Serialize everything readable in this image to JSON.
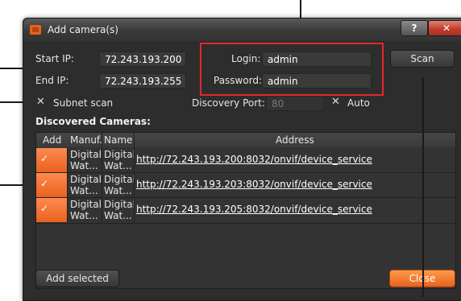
{
  "dialog": {
    "title": "Add camera(s)",
    "help_label": "?",
    "close_label": "✕"
  },
  "form": {
    "start_ip_label": "Start IP:",
    "start_ip_value": "72.243.193.200",
    "end_ip_label": "End IP:",
    "end_ip_value": "72.243.193.255",
    "login_label": "Login:",
    "login_value": "admin",
    "password_label": "Password:",
    "password_value": "admin",
    "scan_label": "Scan",
    "subnet_scan_label": "Subnet scan",
    "discovery_port_label": "Discovery Port:",
    "discovery_port_value": "80",
    "auto_label": "Auto"
  },
  "cameras": {
    "section_title": "Discovered Cameras:",
    "columns": [
      "Add",
      "Manuf.",
      "Name",
      "Address"
    ],
    "rows": [
      {
        "manuf": "Digital Wat...",
        "name": "Digital Wat...",
        "address": "http://72.243.193.200:8032/onvif/device_service"
      },
      {
        "manuf": "Digital Wat...",
        "name": "Digital Wat...",
        "address": "http://72.243.193.203:8032/onvif/device_service"
      },
      {
        "manuf": "Digital Wat...",
        "name": "Digital Wat...",
        "address": "http://72.243.193.205:8032/onvif/device_service"
      }
    ]
  },
  "footer": {
    "add_selected_label": "Add selected",
    "close_label": "Close"
  },
  "colors": {
    "accent": "#e8621e",
    "highlight_box": "#e8262a",
    "dialog_bg": "#2d2d2d"
  }
}
